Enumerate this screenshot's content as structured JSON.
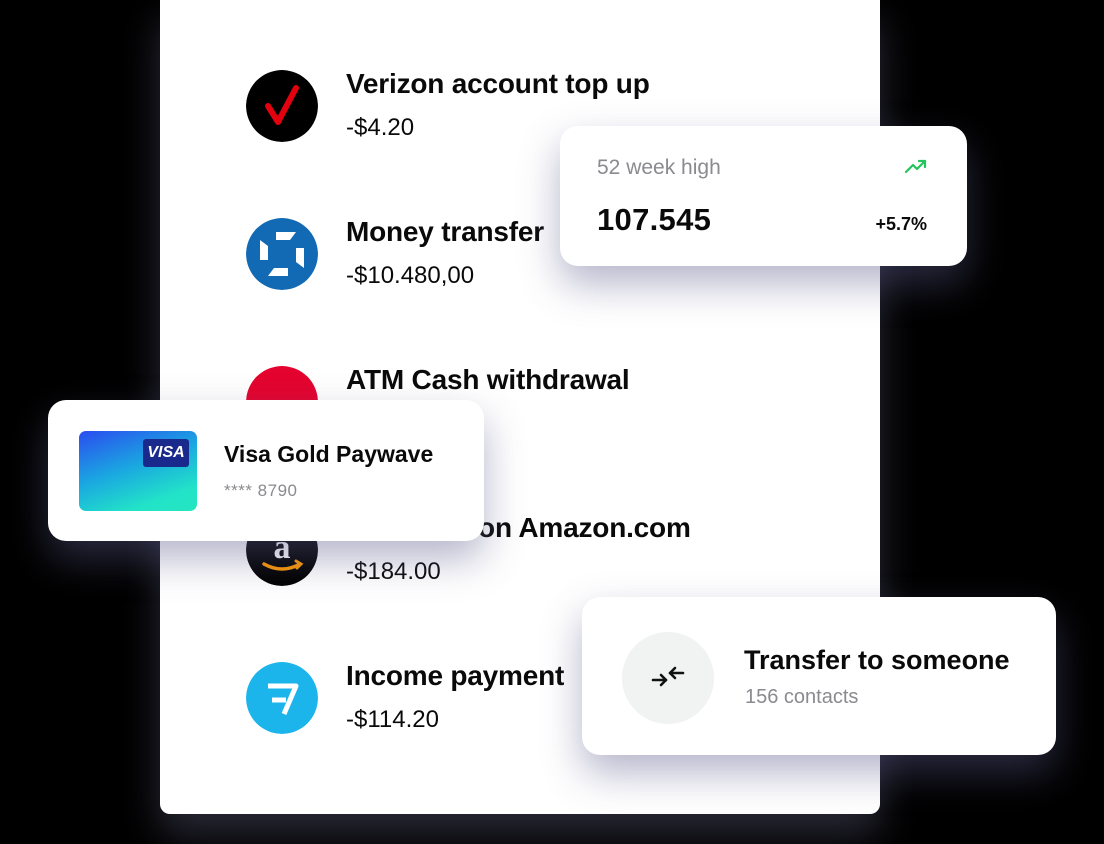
{
  "transactions": [
    {
      "title": "Verizon account top up",
      "amount": "-$4.20",
      "logo": "verizon-logo",
      "logo_bg": "#000000",
      "accent": "#e3000f"
    },
    {
      "title": "Money transfer",
      "amount": "-$10.480,00",
      "logo": "chase-logo",
      "logo_bg": "#1269b4"
    },
    {
      "title": "ATM Cash withdrawal",
      "amount": "",
      "logo": "bank-logo",
      "logo_bg": "#e4032e"
    },
    {
      "title": "Purchase on Amazon.com",
      "amount": "-$184.00",
      "logo": "amazon-logo",
      "logo_bg": "#000000",
      "accent": "#ff9900"
    },
    {
      "title": "Income payment",
      "amount": "-$114.20",
      "logo": "wise-logo",
      "logo_bg": "#1bb5ec"
    }
  ],
  "stock_card": {
    "label": "52 week high",
    "value": "107.545",
    "change": "+5.7%",
    "trend_icon": "trending-up-icon",
    "trend_color": "#22c55e"
  },
  "card_widget": {
    "brand": "VISA",
    "name": "Visa Gold Paywave",
    "number": "**** 8790"
  },
  "transfer_widget": {
    "icon": "transfer-arrows-icon",
    "title": "Transfer to someone",
    "subtitle": "156 contacts"
  }
}
